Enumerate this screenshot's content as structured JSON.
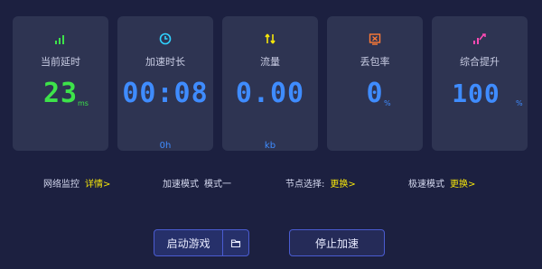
{
  "colors": {
    "background": "#1c2040",
    "card": "#2e3452",
    "green": "#3de34a",
    "blue": "#3f8cff",
    "yellow": "#f5e50a",
    "orange": "#ff7a36",
    "magenta": "#ff4ab4",
    "cyan": "#2fd2ff"
  },
  "stats": [
    {
      "icon": "signal-bars-icon",
      "label": "当前延时",
      "value": "23",
      "unit": "ms",
      "sub": ""
    },
    {
      "icon": "clock-icon",
      "label": "加速时长",
      "value": "00:08",
      "unit": "",
      "sub": "0h"
    },
    {
      "icon": "up-down-arrows-icon",
      "label": "流量",
      "value": "0.00",
      "unit": "",
      "sub": "kb"
    },
    {
      "icon": "packet-loss-icon",
      "label": "丢包率",
      "value": "0",
      "unit": "%",
      "sub": ""
    },
    {
      "icon": "trend-up-icon",
      "label": "综合提升",
      "value": "100",
      "unit": "%",
      "sub": ""
    }
  ],
  "info": {
    "network_label": "网络监控",
    "network_link": "详情>",
    "mode_label": "加速模式",
    "mode_value": "模式一",
    "node_label": "节点选择:",
    "node_link": "更换>",
    "extreme_label": "极速模式",
    "extreme_link": "更换>"
  },
  "buttons": {
    "start": "启动游戏",
    "stop": "停止加速"
  }
}
